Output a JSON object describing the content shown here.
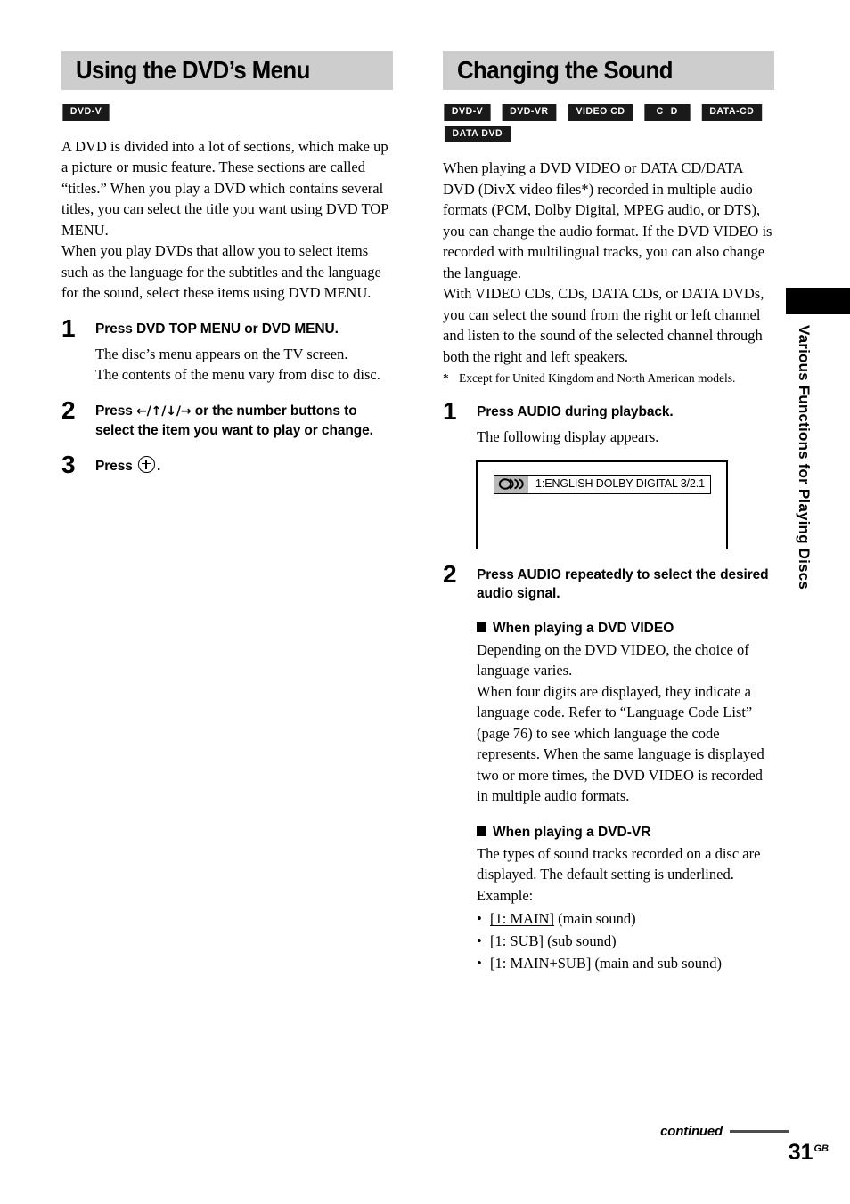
{
  "page": {
    "number": "31",
    "region_code": "GB",
    "continued_label": "continued",
    "side_tab_label": "Various Functions for Playing Discs"
  },
  "left_column": {
    "title": "Using the DVD’s Menu",
    "badges": [
      "DVD-V"
    ],
    "intro": [
      "A DVD is divided into a lot of sections, which make up a picture or music feature. These sections are called “titles.” When you play a DVD which contains several titles, you can select the title you want using DVD TOP MENU.",
      "When you play DVDs that allow you to select items such as the language for the subtitles and the language for the sound, select these items using DVD MENU."
    ],
    "steps": [
      {
        "number": "1",
        "heading": "Press DVD TOP MENU or DVD MENU.",
        "desc": [
          "The disc’s menu appears on the TV screen.",
          "The contents of the menu vary from disc to disc."
        ]
      },
      {
        "number": "2",
        "heading_pre": "Press ",
        "heading_arrows": "←/↑/↓/→",
        "heading_post": " or the number buttons to select the item you want to play or change.",
        "desc": []
      },
      {
        "number": "3",
        "heading_pre": "Press ",
        "heading_post": ".",
        "icon": "enter-button-icon",
        "desc": []
      }
    ]
  },
  "right_column": {
    "title": "Changing the Sound",
    "badges": [
      "DVD-V",
      "DVD-VR",
      "VIDEO CD",
      "C D",
      "DATA-CD",
      "DATA DVD"
    ],
    "intro": [
      "When playing a DVD VIDEO or DATA CD/DATA DVD (DivX video files*) recorded in multiple audio formats (PCM, Dolby Digital, MPEG audio, or DTS), you can change the audio format. If the DVD VIDEO is recorded with multilingual tracks, you can also change the language.",
      "With VIDEO CDs, CDs, DATA CDs, or DATA DVDs, you can select the sound from the right or left channel and listen to the sound of the selected channel through both the right and left speakers."
    ],
    "footnote": {
      "mark": "*",
      "text": "Except for United Kingdom and North American models."
    },
    "steps": [
      {
        "number": "1",
        "heading": "Press AUDIO during playback.",
        "desc": [
          "The following display appears."
        ]
      },
      {
        "number": "2",
        "heading": "Press AUDIO repeatedly to select the desired audio signal.",
        "desc": []
      }
    ],
    "display_figure": {
      "icon": "dolby-audio-icon",
      "text": "1:ENGLISH  DOLBY DIGITAL 3/2.1"
    },
    "subsections": [
      {
        "heading": "When playing a DVD VIDEO",
        "paragraphs": [
          "Depending on the DVD VIDEO, the choice of language varies.",
          "When four digits are displayed, they indicate a language code. Refer to “Language Code List” (page 76) to see which language the code represents. When the same language is displayed two or more times, the DVD VIDEO is recorded in multiple audio formats."
        ]
      },
      {
        "heading": "When playing a DVD-VR",
        "paragraphs": [
          "The types of sound tracks recorded on a disc are displayed. The default setting is underlined.",
          "Example:"
        ],
        "bullets": [
          {
            "code": "[1: MAIN]",
            "underlined": true,
            "note": " (main sound)"
          },
          {
            "code": "[1: SUB]",
            "underlined": false,
            "note": " (sub sound)"
          },
          {
            "code": "[1: MAIN+SUB]",
            "underlined": false,
            "note": " (main and sub sound)"
          }
        ]
      }
    ]
  }
}
